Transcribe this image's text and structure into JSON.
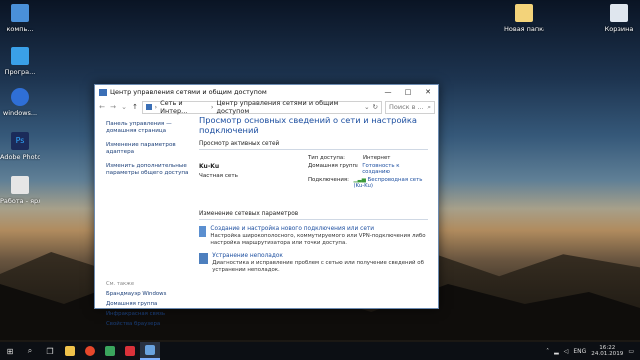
{
  "desktop": {
    "icons_left": [
      {
        "label": "компь...",
        "icon": "computer-icon",
        "color": "#4a90d9"
      },
      {
        "label": "Програ...",
        "icon": "program-icon",
        "color": "#3aa0e8"
      },
      {
        "label": "windows...",
        "icon": "windows-app-icon",
        "color": "#2f6fd6"
      },
      {
        "label": "Adobe Photosh...",
        "icon": "photoshop-icon",
        "color": "#1b2b5a"
      },
      {
        "label": "Работа - ярлык",
        "icon": "document-shortcut-icon",
        "color": "#e6e6e6"
      }
    ],
    "icons_right": [
      {
        "label": "Новая папка",
        "icon": "folder-icon",
        "color": "#f3d37a"
      },
      {
        "label": "Корзина",
        "icon": "recycle-bin-icon",
        "color": "#dfe6ee"
      }
    ]
  },
  "window": {
    "title": "Центр управления сетями и общим доступом",
    "minimize": "—",
    "maximize": "□",
    "close": "✕",
    "address": {
      "crumb1": "Сеть и Интер...",
      "crumb2": "Центр управления сетями и общим доступом"
    },
    "search_placeholder": "Поиск в ...",
    "left_pane": {
      "home_link": "Панель управления — домашняя страница",
      "link_adapter": "Изменение параметров адаптера",
      "link_sharing": "Изменить дополнительные параметры общего доступа",
      "see_also": "См. также",
      "see_also_links": [
        "Брандмауэр Windows",
        "Домашняя группа",
        "Инфракрасная связь",
        "Свойства браузера"
      ]
    },
    "main": {
      "heading": "Просмотр основных сведений о сети и настройка подключений",
      "active_networks": "Просмотр активных сетей",
      "network_name": "Ku-Ku",
      "network_type": "Частная сеть",
      "access_type_label": "Тип доступа:",
      "access_type_value": "Интернет",
      "homegroup_label": "Домашняя группа:",
      "homegroup_value": "Готовность к созданию",
      "connections_label": "Подключения:",
      "connections_value": "Беспроводная сеть (Ku-Ku)",
      "change_settings": "Изменение сетевых параметров",
      "task1_link": "Создание и настройка нового подключения или сети",
      "task1_desc": "Настройка широкополосного, коммутируемого или VPN-подключения либо настройка маршрутизатора или точки доступа.",
      "task2_link": "Устранение неполадок",
      "task2_desc": "Диагностика и исправление проблем с сетью или получение сведений об устранении неполадок."
    }
  },
  "taskbar": {
    "lang": "ENG",
    "time": "16:22",
    "date": "24.01.2019"
  }
}
